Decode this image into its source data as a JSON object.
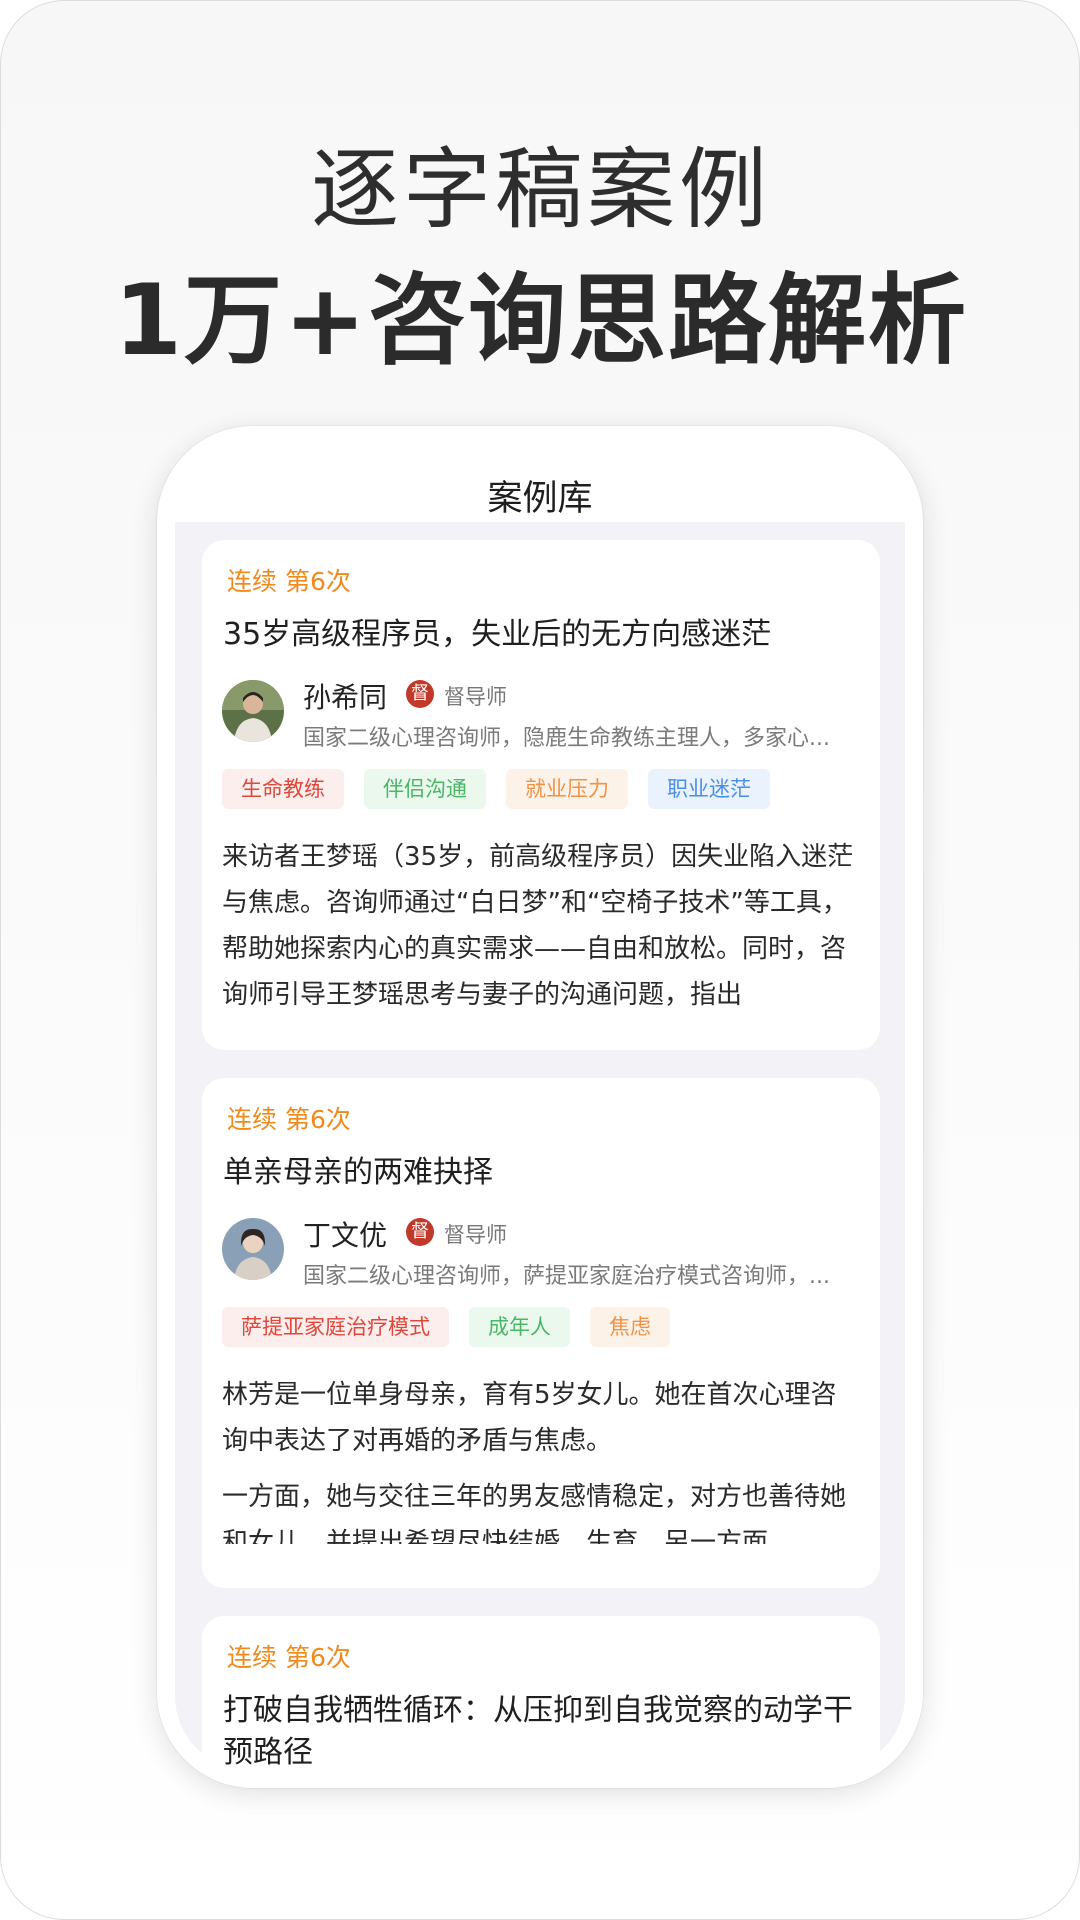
{
  "promo": {
    "headline_line1": "逐字稿案例",
    "headline_line2": "1万+咨询思路解析"
  },
  "screen": {
    "nav_title": "案例库"
  },
  "cases": [
    {
      "streak": "连续 第6次",
      "title": "35岁高级程序员，失业后的无方向感迷茫",
      "coach_name": "孙希同",
      "badge": "督",
      "role": "督导师",
      "coach_desc": "国家二级心理咨询师，隐鹿生命教练主理人，多家心...",
      "tags": [
        "生命教练",
        "伴侣沟通",
        "就业压力",
        "职业迷茫"
      ],
      "summary_p1": "来访者王梦瑶（35岁，前高级程序员）因失业陷入迷茫与焦虑。咨询师通过“白日梦”和“空椅子技术”等工具，帮助她探索内心的真实需求——自由和放松。同时，咨询师引导王梦瑶思考与妻子的沟通问题，指出"
    },
    {
      "streak": "连续 第6次",
      "title": "单亲母亲的两难抉择",
      "coach_name": "丁文优",
      "badge": "督",
      "role": "督导师",
      "coach_desc": "国家二级心理咨询师，萨提亚家庭治疗模式咨询师，...",
      "tags": [
        "萨提亚家庭治疗模式",
        "成年人",
        "焦虑"
      ],
      "summary_p1": "林芳是一位单身母亲，育有5岁女儿。她在首次心理咨询中表达了对再婚的矛盾与焦虑。",
      "summary_p2": "一方面，她与交往三年的男友感情稳定，对方也善待她和女儿，并提出希望尽快结婚、生育。另一方面，"
    },
    {
      "streak": "连续 第6次",
      "title": "打破自我牺牲循环：从压抑到自我觉察的动学干预路径"
    }
  ],
  "colors": {
    "accent_orange": "#f08a1c",
    "badge_red": "#c0392b"
  }
}
